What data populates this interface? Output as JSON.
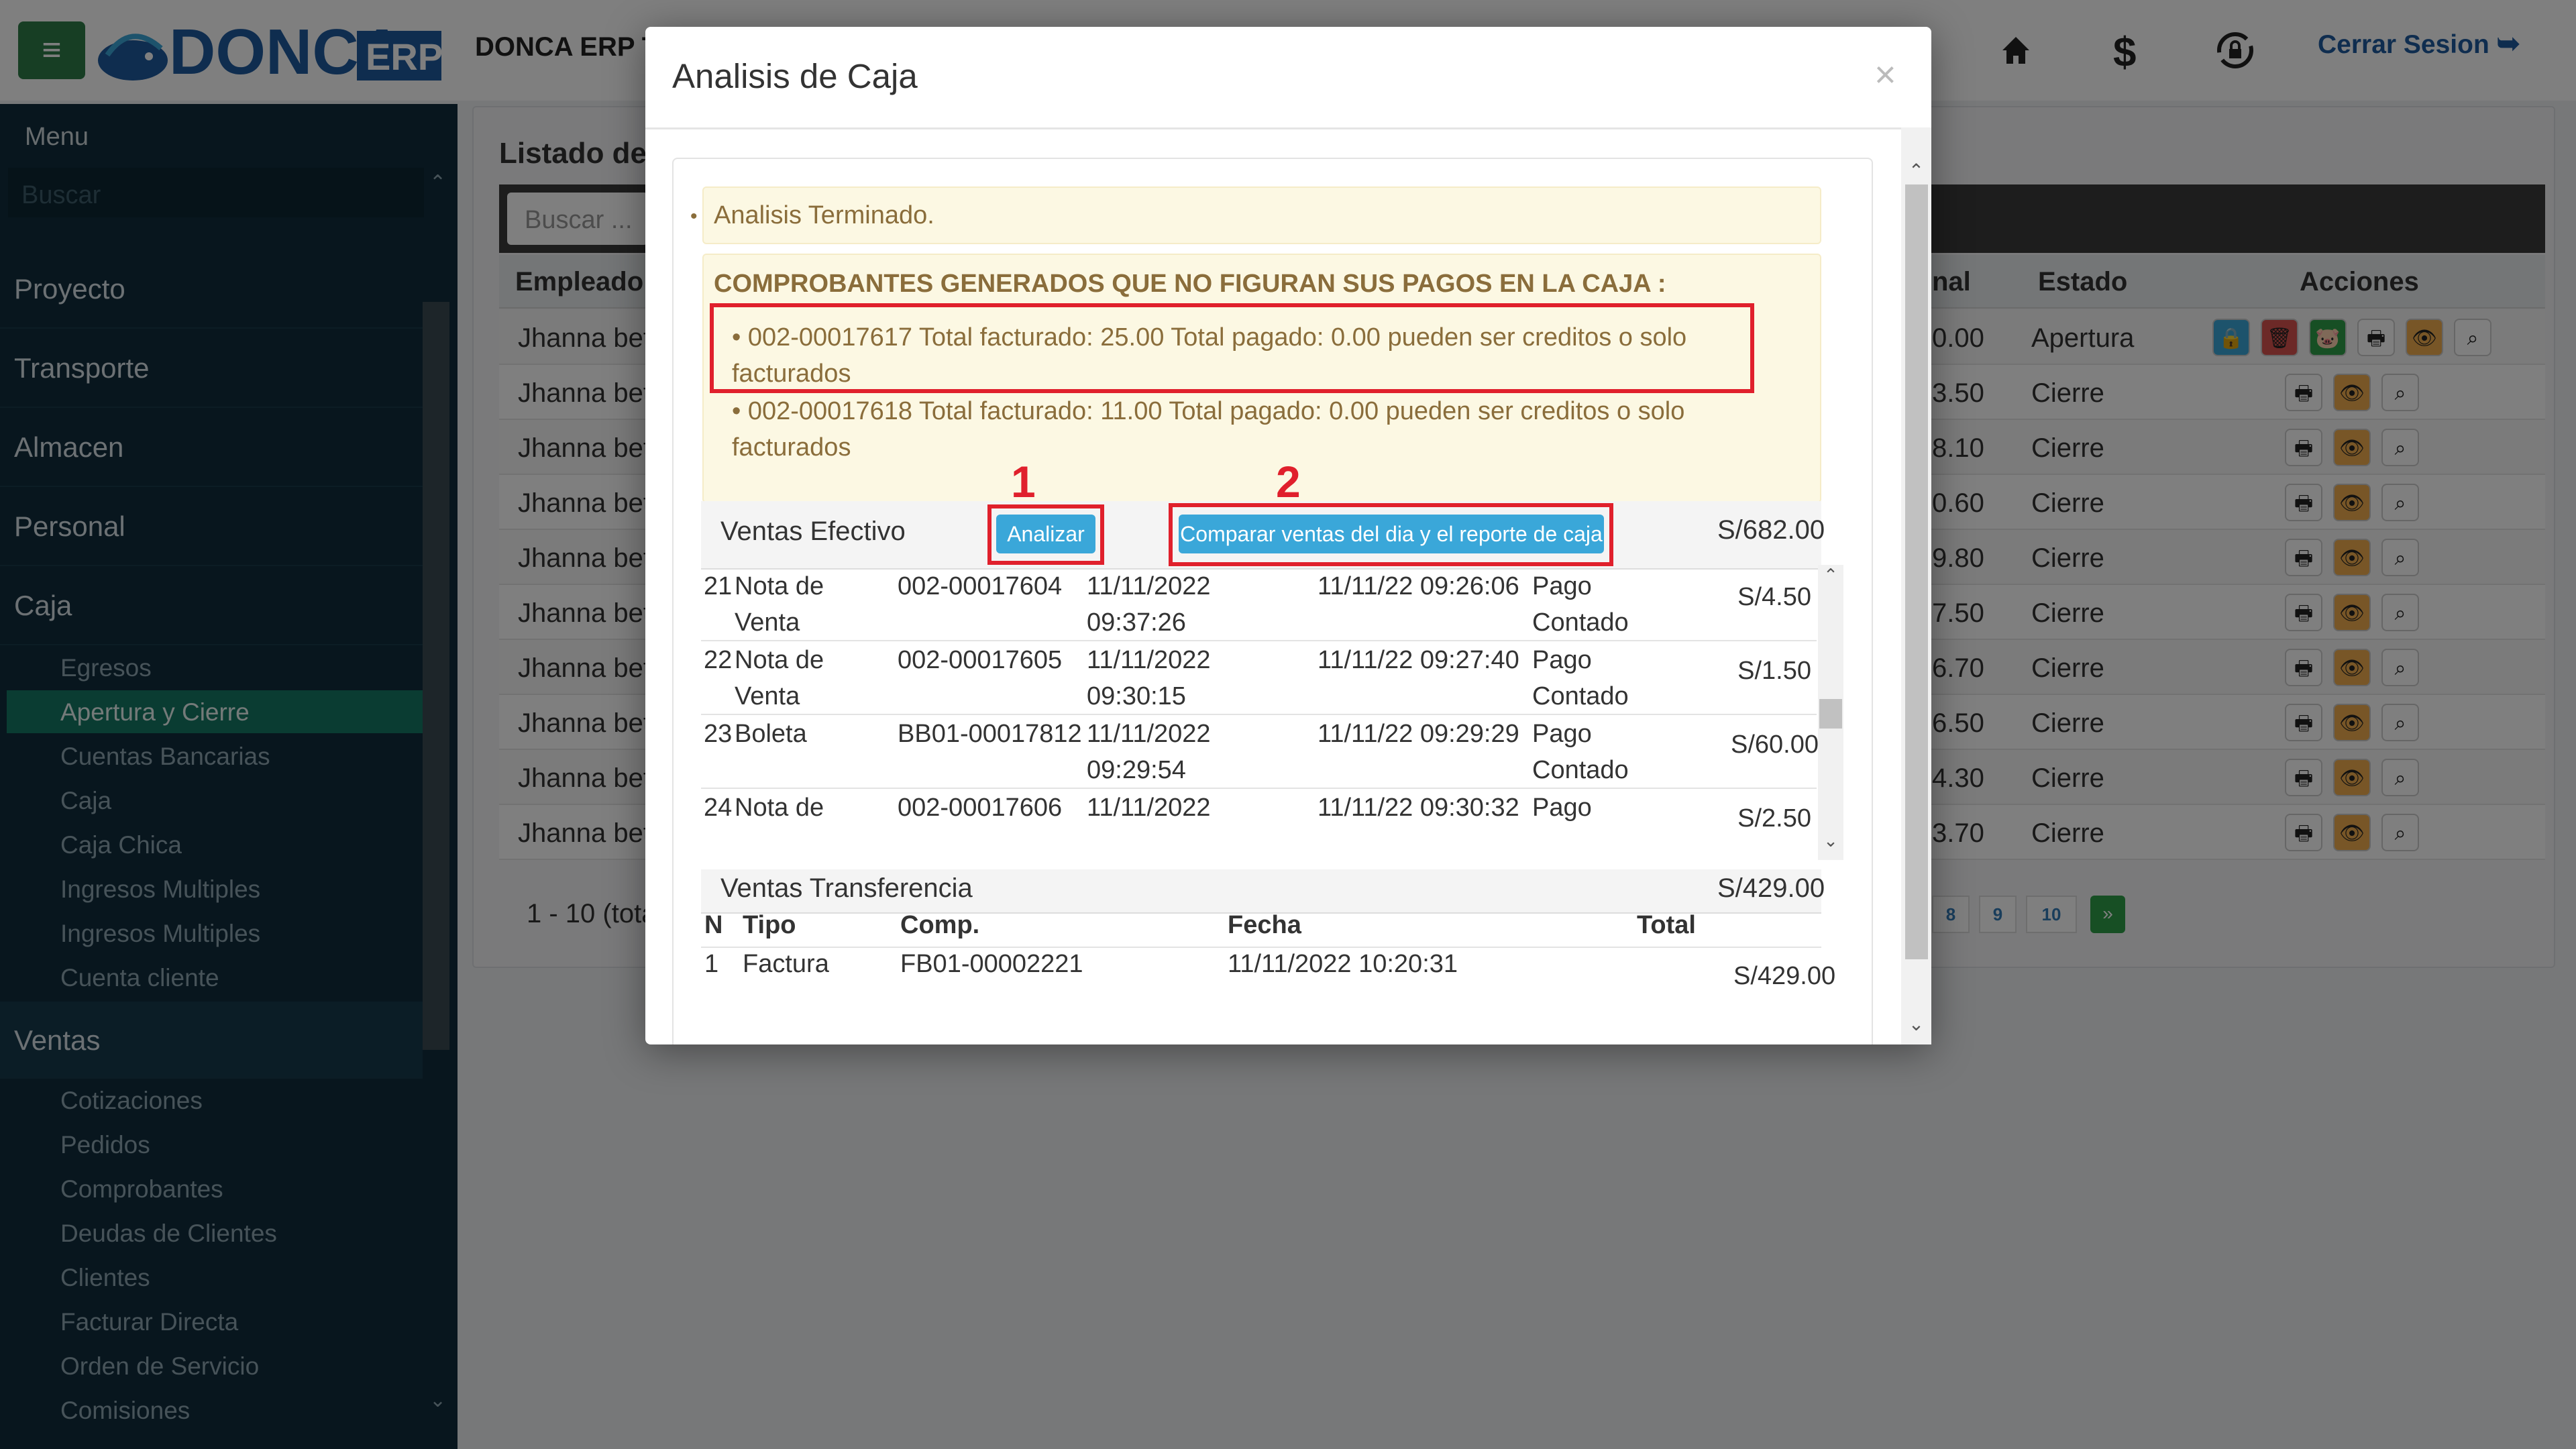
{
  "header": {
    "app_title": "DONCA ERP T",
    "logo_text": "DONCA",
    "logo_badge": "ERP",
    "logout_label": "Cerrar Sesion"
  },
  "sidebar": {
    "menu_title": "Menu",
    "search_placeholder": "Buscar",
    "sections": [
      "Proyecto",
      "Transporte",
      "Almacen",
      "Personal",
      "Caja"
    ],
    "caja_items": [
      "Egresos",
      "Apertura y Cierre",
      "Cuentas Bancarias",
      "Caja",
      "Caja Chica",
      "Ingresos Multiples",
      "Ingresos Multiples",
      "Cuenta cliente"
    ],
    "ventas_title": "Ventas",
    "ventas_items": [
      "Cotizaciones",
      "Pedidos",
      "Comprobantes",
      "Deudas de Clientes",
      "Clientes",
      "Facturar Directa",
      "Orden de Servicio",
      "Comisiones"
    ]
  },
  "background": {
    "list_title": "Listado de",
    "search_placeholder": "Buscar ...",
    "columns": {
      "empleado": "Empleado",
      "total": "nal",
      "estado": "Estado",
      "acciones": "Acciones"
    },
    "rows": [
      {
        "empleado": "Jhanna bet",
        "total": "0.00",
        "estado": "Apertura"
      },
      {
        "empleado": "Jhanna bet",
        "total": "3.50",
        "estado": "Cierre"
      },
      {
        "empleado": "Jhanna bet",
        "total": "8.10",
        "estado": "Cierre"
      },
      {
        "empleado": "Jhanna bet",
        "total": "0.60",
        "estado": "Cierre"
      },
      {
        "empleado": "Jhanna bet",
        "total": "9.80",
        "estado": "Cierre"
      },
      {
        "empleado": "Jhanna bet",
        "total": "7.50",
        "estado": "Cierre"
      },
      {
        "empleado": "Jhanna bet",
        "total": "6.70",
        "estado": "Cierre"
      },
      {
        "empleado": "Jhanna bet",
        "total": "6.50",
        "estado": "Cierre"
      },
      {
        "empleado": "Jhanna bet",
        "total": "4.30",
        "estado": "Cierre"
      },
      {
        "empleado": "Jhanna bet",
        "total": "3.70",
        "estado": "Cierre"
      }
    ],
    "pagination_info": "1 - 10 (tota",
    "pages": [
      "8",
      "9",
      "10",
      "»"
    ]
  },
  "modal": {
    "title": "Analisis de Caja",
    "close": "×",
    "status": "Analisis Terminado.",
    "warning_title": "COMPROBANTES GENERADOS QUE NO FIGURAN SUS PAGOS EN LA CAJA :",
    "warnings": [
      {
        "line1": "• 002-00017617   Total facturado: 25.00   Total pagado: 0.00    pueden ser creditos o solo",
        "line2": "facturados"
      },
      {
        "line1": "• 002-00017618   Total facturado: 11.00   Total pagado: 0.00    pueden ser creditos o solo",
        "line2": "facturados"
      }
    ],
    "callouts": [
      "1",
      "2"
    ],
    "efectivo": {
      "title": "Ventas Efectivo",
      "analizar_label": "Analizar",
      "comparar_label": "Comparar ventas del dia y el reporte de caja",
      "total": "S/682.00",
      "rows": [
        {
          "n": "21",
          "tipo1": "Nota de",
          "tipo2": "Venta",
          "comp": "002-00017604",
          "fecha1": "11/11/2022",
          "fecha2": "09:37:26",
          "hora": "11/11/22 09:26:06",
          "pago1": "Pago",
          "pago2": "Contado",
          "monto": "S/4.50"
        },
        {
          "n": "22",
          "tipo1": "Nota de",
          "tipo2": "Venta",
          "comp": "002-00017605",
          "fecha1": "11/11/2022",
          "fecha2": "09:30:15",
          "hora": "11/11/22 09:27:40",
          "pago1": "Pago",
          "pago2": "Contado",
          "monto": "S/1.50"
        },
        {
          "n": "23",
          "tipo1": "Boleta",
          "tipo2": "",
          "comp": "BB01-00017812",
          "fecha1": "11/11/2022",
          "fecha2": "09:29:54",
          "hora": "11/11/22 09:29:29",
          "pago1": "Pago",
          "pago2": "Contado",
          "monto": "S/60.00"
        },
        {
          "n": "24",
          "tipo1": "Nota de",
          "tipo2": "",
          "comp": "002-00017606",
          "fecha1": "11/11/2022",
          "fecha2": "",
          "hora": "11/11/22 09:30:32",
          "pago1": "Pago",
          "pago2": "",
          "monto": "S/2.50"
        }
      ]
    },
    "transferencia": {
      "title": "Ventas Transferencia",
      "total": "S/429.00",
      "headers": {
        "n": "N",
        "tipo": "Tipo",
        "comp": "Comp.",
        "fecha": "Fecha",
        "total": "Total"
      },
      "row": {
        "n": "1",
        "tipo": "Factura",
        "comp": "FB01-00002221",
        "fecha": "11/11/2022 10:20:31",
        "total": "S/429.00"
      }
    }
  },
  "colors": {
    "accent_green": "#147864",
    "brand_blue": "#1f5a9e",
    "info_button": "#3aa7d9",
    "highlight_red": "#e0202c",
    "warning_bg": "#fcf8e3"
  }
}
